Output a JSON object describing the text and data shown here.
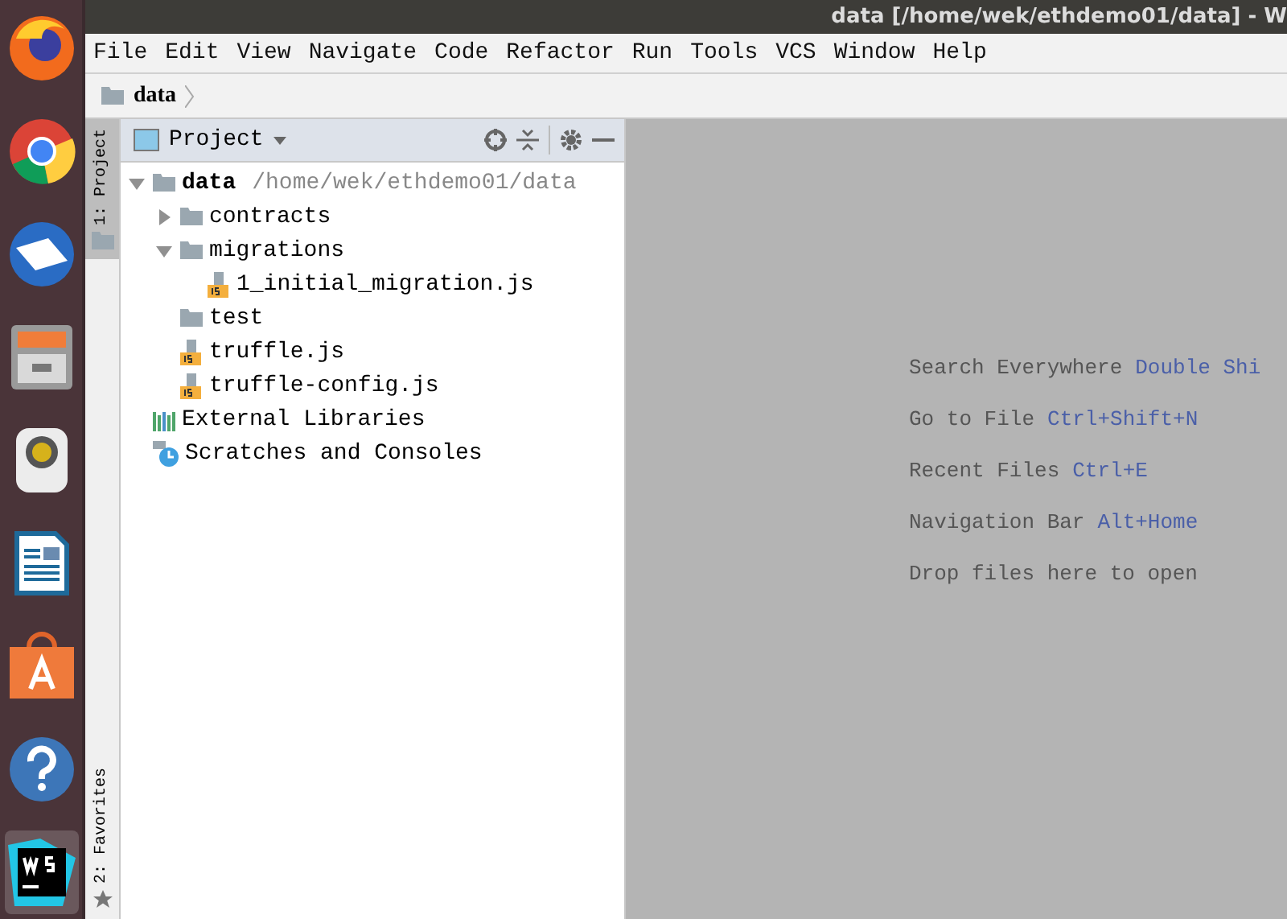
{
  "window": {
    "title": "data [/home/wek/ethdemo01/data] - W"
  },
  "dock": [
    {
      "kind": "firefox",
      "selected": false
    },
    {
      "kind": "chrome",
      "selected": false
    },
    {
      "kind": "mail",
      "selected": false
    },
    {
      "kind": "files",
      "selected": false
    },
    {
      "kind": "speaker",
      "selected": false
    },
    {
      "kind": "writer",
      "selected": false
    },
    {
      "kind": "store",
      "selected": false
    },
    {
      "kind": "help",
      "selected": false
    },
    {
      "kind": "webstorm",
      "selected": true
    }
  ],
  "menu": [
    {
      "label": "File"
    },
    {
      "label": "Edit"
    },
    {
      "label": "View"
    },
    {
      "label": "Navigate"
    },
    {
      "label": "Code"
    },
    {
      "label": "Refactor"
    },
    {
      "label": "Run"
    },
    {
      "label": "Tools"
    },
    {
      "label": "VCS"
    },
    {
      "label": "Window"
    },
    {
      "label": "Help"
    }
  ],
  "breadcrumb": {
    "label": "data"
  },
  "tool_strip": {
    "top": {
      "label": "1: Project",
      "selected": true
    },
    "bottom": {
      "label": "2: Favorites",
      "selected": false
    }
  },
  "project_panel": {
    "title": "Project",
    "tree": [
      {
        "label": "data",
        "path": "/home/wek/ethdemo01/data",
        "kind": "folder",
        "expanded": true,
        "children": [
          {
            "label": "contracts",
            "kind": "folder",
            "expanded": false
          },
          {
            "label": "migrations",
            "kind": "folder",
            "expanded": true,
            "children": [
              {
                "label": "1_initial_migration.js",
                "kind": "js-file"
              }
            ]
          },
          {
            "label": "test",
            "kind": "folder"
          },
          {
            "label": "truffle.js",
            "kind": "js-file"
          },
          {
            "label": "truffle-config.js",
            "kind": "js-file"
          }
        ]
      },
      {
        "label": "External Libraries",
        "kind": "libraries"
      },
      {
        "label": "Scratches and Consoles",
        "kind": "scratches"
      }
    ]
  },
  "editor_hints": [
    {
      "text": "Search Everywhere",
      "shortcut": "Double Shi"
    },
    {
      "text": "Go to File",
      "shortcut": "Ctrl+Shift+N"
    },
    {
      "text": "Recent Files",
      "shortcut": "Ctrl+E"
    },
    {
      "text": "Navigation Bar",
      "shortcut": "Alt+Home"
    },
    {
      "text": "Drop files here to open"
    }
  ]
}
